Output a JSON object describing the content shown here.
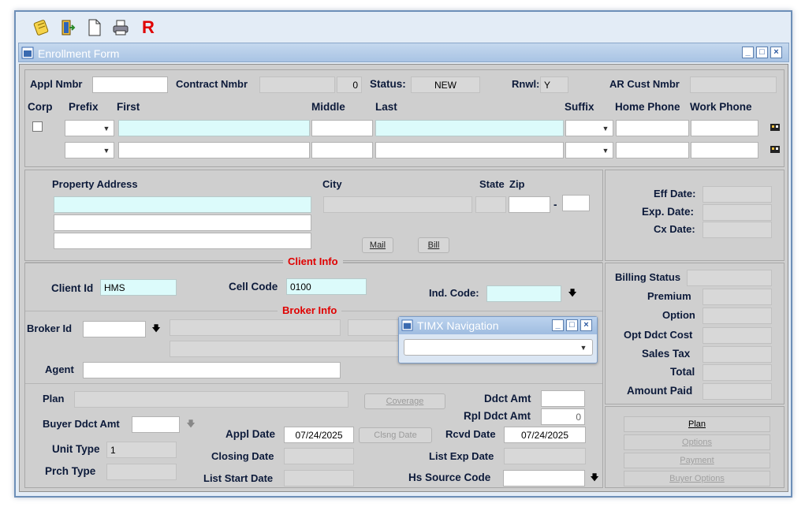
{
  "toolbar": {
    "r_label": "R"
  },
  "window": {
    "title": "Enrollment Form"
  },
  "header": {
    "appl_nmbr_label": "Appl Nmbr",
    "contract_nmbr_label": "Contract Nmbr",
    "contract_count": "0",
    "status_label": "Status:",
    "status_value": "NEW",
    "rnwl_label": "Rnwl:",
    "rnwl_value": "Y",
    "ar_cust_label": "AR Cust Nmbr",
    "corp_label": "Corp",
    "prefix_label": "Prefix",
    "first_label": "First",
    "middle_label": "Middle",
    "last_label": "Last",
    "suffix_label": "Suffix",
    "home_phone_label": "Home Phone",
    "work_phone_label": "Work Phone"
  },
  "address": {
    "property_label": "Property Address",
    "city_label": "City",
    "state_label": "State",
    "zip_label": "Zip",
    "zip_sep": "-",
    "mail_btn": "Mail",
    "bill_btn": "Bill"
  },
  "dates": {
    "eff_label": "Eff Date:",
    "exp_label": "Exp. Date:",
    "cx_label": "Cx Date:"
  },
  "client": {
    "section": "Client Info",
    "client_id_label": "Client Id",
    "client_id": "HMS",
    "cell_code_label": "Cell Code",
    "cell_code": "0100",
    "ind_code_label": "Ind. Code:"
  },
  "broker": {
    "section": "Broker Info",
    "broker_id_label": "Broker Id",
    "agent_label": "Agent"
  },
  "billing": {
    "status_label": "Billing Status",
    "premium_label": "Premium",
    "option_label": "Option",
    "opt_ddct_label": "Opt Ddct Cost",
    "sales_tax_label": "Sales Tax",
    "total_label": "Total",
    "amount_paid_label": "Amount Paid"
  },
  "plan": {
    "plan_label": "Plan",
    "coverage_btn": "Coverage",
    "ddct_amt_label": "Ddct Amt",
    "rpl_ddct_label": "Rpl Ddct Amt",
    "rpl_ddct_value": "0",
    "buyer_ddct_label": "Buyer Ddct Amt",
    "appl_date_label": "Appl Date",
    "appl_date": "07/24/2025",
    "clsng_date_btn": "Clsng Date",
    "rcvd_date_label": "Rcvd Date",
    "rcvd_date": "07/24/2025",
    "unit_type_label": "Unit Type",
    "unit_type": "1",
    "closing_date_label": "Closing Date",
    "list_exp_label": "List Exp Date",
    "prch_type_label": "Prch Type",
    "list_start_label": "List Start Date",
    "hs_source_label": "Hs Source Code"
  },
  "actions": {
    "plan_btn": "Plan",
    "options_btn": "Options",
    "payment_btn": "Payment",
    "buyer_options_btn": "Buyer Options"
  },
  "nav": {
    "title": "TIMX Navigation"
  }
}
